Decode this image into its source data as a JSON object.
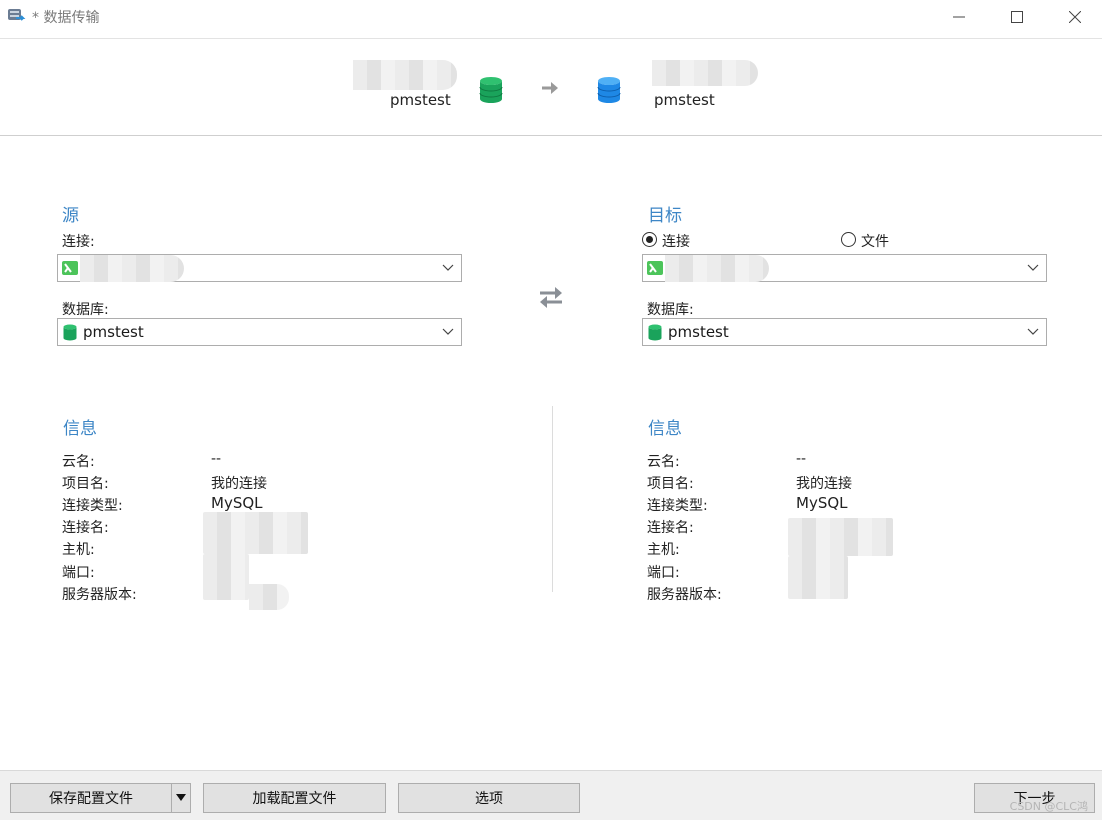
{
  "window": {
    "title": "* 数据传输"
  },
  "banner": {
    "source_db": "pmstest",
    "target_db": "pmstest"
  },
  "source": {
    "section_title": "源",
    "connection_label": "连接:",
    "database_label": "数据库:",
    "database_value": "pmstest"
  },
  "target": {
    "section_title": "目标",
    "radio_connection": "连接",
    "radio_file": "文件",
    "database_label": "数据库:",
    "database_value": "pmstest"
  },
  "source_info": {
    "title": "信息",
    "rows": [
      {
        "label": "云名:",
        "value": "--"
      },
      {
        "label": "项目名:",
        "value": "我的连接"
      },
      {
        "label": "连接类型:",
        "value": "MySQL"
      },
      {
        "label": "连接名:",
        "value": ""
      },
      {
        "label": "主机:",
        "value": ""
      },
      {
        "label": "端口:",
        "value": ""
      },
      {
        "label": "服务器版本:",
        "value": ""
      }
    ]
  },
  "target_info": {
    "title": "信息",
    "rows": [
      {
        "label": "云名:",
        "value": "--"
      },
      {
        "label": "项目名:",
        "value": "我的连接"
      },
      {
        "label": "连接类型:",
        "value": "MySQL"
      },
      {
        "label": "连接名:",
        "value": ""
      },
      {
        "label": "主机:",
        "value": ""
      },
      {
        "label": "端口:",
        "value": ""
      },
      {
        "label": "服务器版本:",
        "value": ""
      }
    ]
  },
  "footer": {
    "save_profile": "保存配置文件",
    "load_profile": "加载配置文件",
    "options": "选项",
    "next": "下一步",
    "watermark": "CSDN @CLC鸿"
  },
  "colors": {
    "accent": "#3d86c6",
    "source_db": "#1aa35b",
    "target_db": "#1e88e5"
  }
}
